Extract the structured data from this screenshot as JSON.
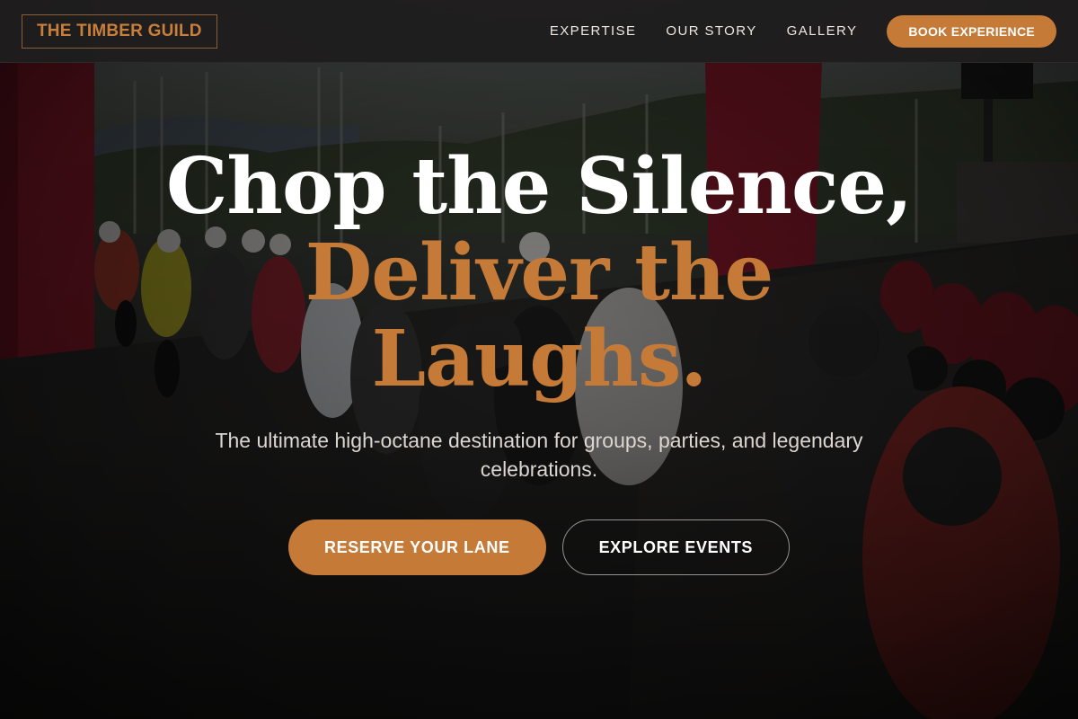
{
  "nav": {
    "logo": "THE TIMBER GUILD",
    "links": [
      "EXPERTISE",
      "OUR STORY",
      "GALLERY"
    ],
    "cta": "BOOK EXPERIENCE"
  },
  "hero": {
    "headline_line1": "Chop the Silence,",
    "headline_line2a": "Deliver the",
    "headline_line2b": "Laughs.",
    "subtitle": "The ultimate high-octane destination for groups, parties, and legendary celebrations.",
    "primary_cta": "RESERVE YOUR LANE",
    "secondary_cta": "EXPLORE EVENTS"
  },
  "colors": {
    "accent": "#c57a37",
    "nav_bg": "#1e1c1c",
    "headline_white": "#ffffff"
  },
  "background": {
    "description_icon": "motorcycle-track-photo"
  }
}
